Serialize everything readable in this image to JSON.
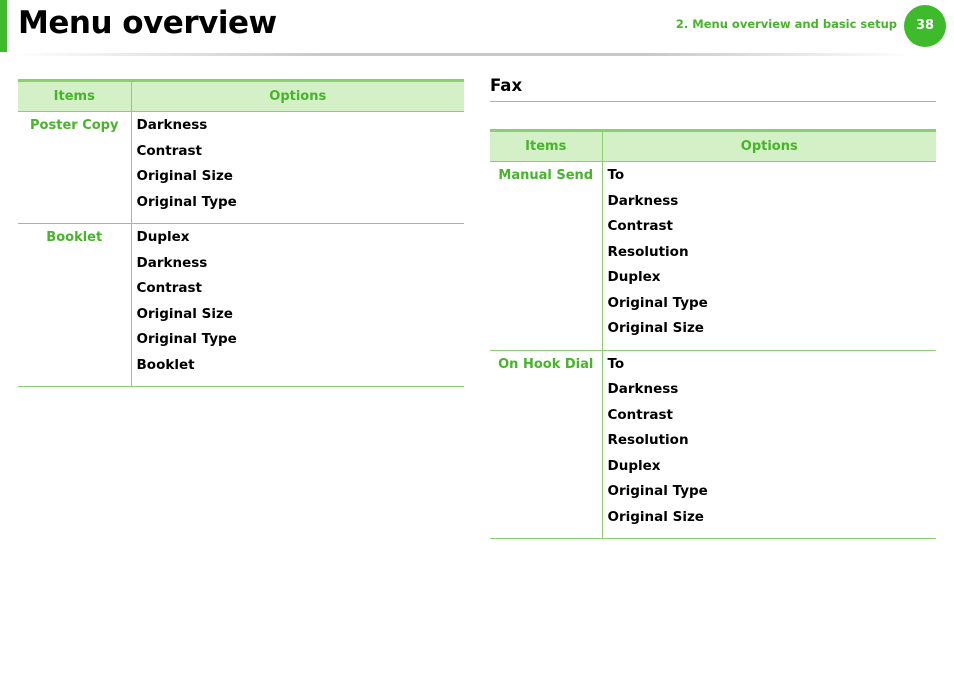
{
  "header": {
    "title": "Menu overview",
    "chapter": "2.  Menu overview and basic setup",
    "page_number": "38"
  },
  "left_table": {
    "col_items": "Items",
    "col_options": "Options",
    "rows": [
      {
        "item": "Poster Copy",
        "options": [
          "Darkness",
          "Contrast",
          "Original Size",
          "Original Type"
        ]
      },
      {
        "item": "Booklet",
        "options": [
          "Duplex",
          "Darkness",
          "Contrast",
          "Original Size",
          "Original Type",
          "Booklet"
        ]
      }
    ]
  },
  "fax": {
    "heading": "Fax",
    "col_items": "Items",
    "col_options": "Options",
    "rows": [
      {
        "item": "Manual Send",
        "options": [
          "To",
          "Darkness",
          "Contrast",
          "Resolution",
          "Duplex",
          "Original Type",
          "Original Size"
        ]
      },
      {
        "item": "On Hook Dial",
        "options": [
          "To",
          "Darkness",
          "Contrast",
          "Resolution",
          "Duplex",
          "Original Type",
          "Original Size"
        ]
      }
    ]
  },
  "colors": {
    "accent": "#3dbb2a",
    "item_text": "#47b52a",
    "header_fill": "#d3f0c7",
    "rule": "#8ad070"
  }
}
